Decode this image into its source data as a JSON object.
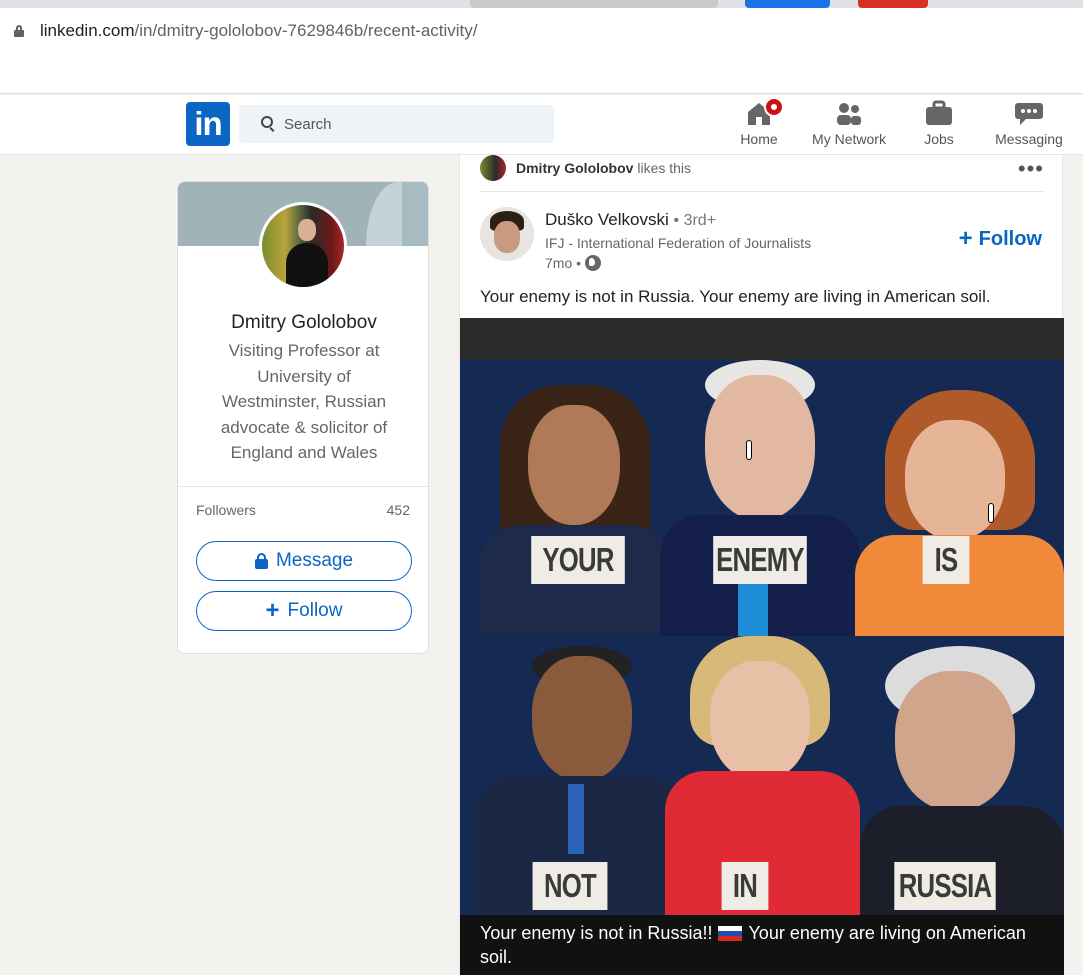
{
  "browser": {
    "url_host": "linkedin.com",
    "url_path": "/in/dmitry-gololobov-7629846b/recent-activity/"
  },
  "header": {
    "logo": "in",
    "search_placeholder": "Search",
    "nav": [
      {
        "label": "Home",
        "icon": "home-icon"
      },
      {
        "label": "My Network",
        "icon": "network-icon"
      },
      {
        "label": "Jobs",
        "icon": "briefcase-icon"
      },
      {
        "label": "Messaging",
        "icon": "messaging-icon"
      }
    ]
  },
  "profile": {
    "name": "Dmitry Gololobov",
    "headline": "Visiting Professor at University of Westminster, Russian advocate & solicitor of England and Wales",
    "followers_label": "Followers",
    "followers_count": "452",
    "message_label": "Message",
    "follow_label": "Follow"
  },
  "post": {
    "activity_actor": "Dmitry Gololobov",
    "activity_text": "likes this",
    "author_name": "Duško Velkovski",
    "author_degree": "• 3rd+",
    "author_subtitle": "IFJ - International Federation of Journalists",
    "time": "7mo •",
    "follow_label": "Follow",
    "text": "Your enemy is not in Russia. Your enemy are living in American soil.",
    "image_signs": [
      "YOUR",
      "ENEMY",
      "IS",
      "NOT",
      "IN",
      "RUSSIA"
    ],
    "caption_a": "Your enemy is not in Russia!!",
    "caption_b": "Your enemy are living on American soil."
  },
  "colors": {
    "brand": "#0a66c2",
    "notification": "#cc1016",
    "page_bg": "#f3f2ef"
  }
}
